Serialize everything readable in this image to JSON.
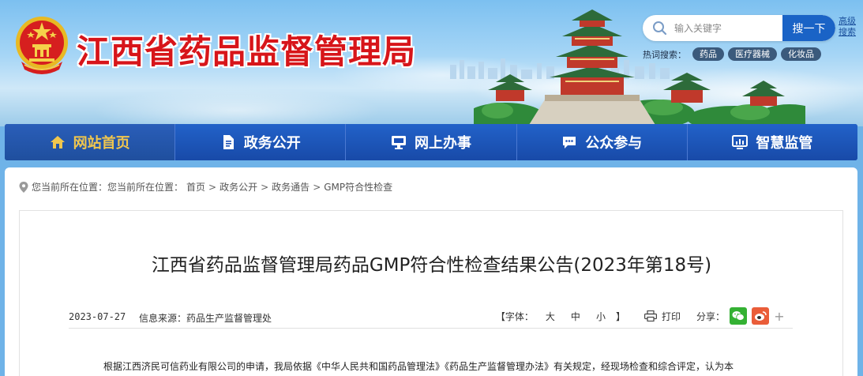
{
  "header": {
    "site_title": "江西省药品监督管理局",
    "search": {
      "placeholder": "输入关键字",
      "button_label": "搜一下",
      "advanced_label": "高级搜索"
    },
    "hot_search": {
      "label": "热词搜索：",
      "tags": [
        "药品",
        "医疗器械",
        "化妆品"
      ]
    }
  },
  "nav": {
    "items": [
      {
        "label": "网站首页",
        "icon": "home-icon",
        "active": true
      },
      {
        "label": "政务公开",
        "icon": "document-icon",
        "active": false
      },
      {
        "label": "网上办事",
        "icon": "monitor-icon",
        "active": false
      },
      {
        "label": "公众参与",
        "icon": "chat-icon",
        "active": false
      },
      {
        "label": "智慧监管",
        "icon": "screen-chart-icon",
        "active": false
      }
    ]
  },
  "breadcrumb": {
    "prefix": "您当前所在位置：您当前所在位置：",
    "items": [
      "首页",
      "政务公开",
      "政务通告",
      "GMP符合性检查"
    ],
    "separator": ">"
  },
  "article": {
    "title": "江西省药品监督管理局药品GMP符合性检查结果公告(2023年第18号)",
    "date": "2023-07-27",
    "source": "信息来源：药品生产监督管理处",
    "font_size_label": "【字体：",
    "font_sizes": [
      "大",
      "中",
      "小"
    ],
    "font_size_close": "】",
    "print_label": "打印",
    "share_label": "分享：",
    "body_first_line": "根据江西济民可信药业有限公司的申请，我局依据《中华人民共和国药品管理法》《药品生产监督管理办法》有关规定，经现场检查和综合评定，认为本"
  },
  "colors": {
    "title_red": "#d7151a",
    "nav_blue": "#1a4fb5",
    "nav_active_text": "#f0c64e",
    "search_button": "#1a63c6",
    "wechat_green": "#34b133",
    "weibo_orange": "#ea5d39"
  }
}
